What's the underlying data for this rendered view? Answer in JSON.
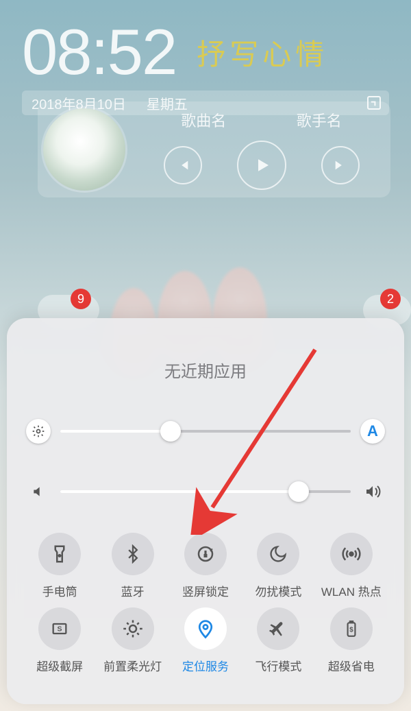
{
  "clock": {
    "time": "08:52",
    "mood": "抒写心情",
    "date": "2018年8月10日",
    "weekday": "星期五"
  },
  "music": {
    "song_label": "歌曲名",
    "artist_label": "歌手名"
  },
  "badges": {
    "left": "9",
    "right": "2"
  },
  "panel": {
    "title": "无近期应用",
    "brightness": {
      "value": 38,
      "auto_label": "A"
    },
    "volume": {
      "value": 82
    },
    "toggles": [
      {
        "id": "flashlight",
        "label": "手电筒",
        "active": false
      },
      {
        "id": "bluetooth",
        "label": "蓝牙",
        "active": false
      },
      {
        "id": "rotation-lock",
        "label": "竖屏锁定",
        "active": false
      },
      {
        "id": "dnd",
        "label": "勿扰模式",
        "active": false
      },
      {
        "id": "hotspot",
        "label": "WLAN 热点",
        "active": false
      },
      {
        "id": "screenshot",
        "label": "超级截屏",
        "active": false
      },
      {
        "id": "fill-light",
        "label": "前置柔光灯",
        "active": false
      },
      {
        "id": "location",
        "label": "定位服务",
        "active": true
      },
      {
        "id": "airplane",
        "label": "飞行模式",
        "active": false
      },
      {
        "id": "battery-saver",
        "label": "超级省电",
        "active": false
      }
    ]
  }
}
